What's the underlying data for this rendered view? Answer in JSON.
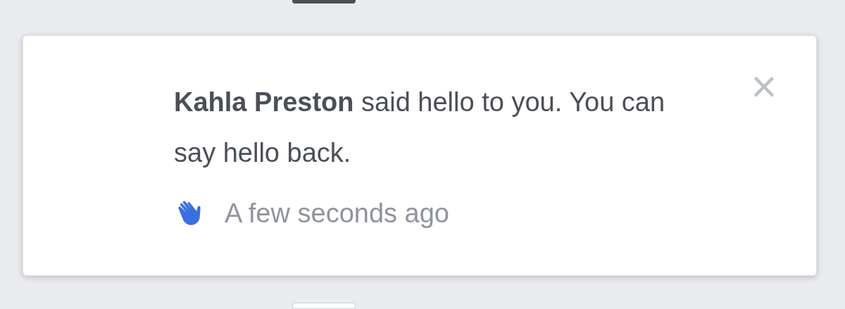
{
  "notification": {
    "message": "**Kahla Preston** said hello to you. You can say hello back.",
    "time": "A few seconds ago",
    "close": "×"
  }
}
